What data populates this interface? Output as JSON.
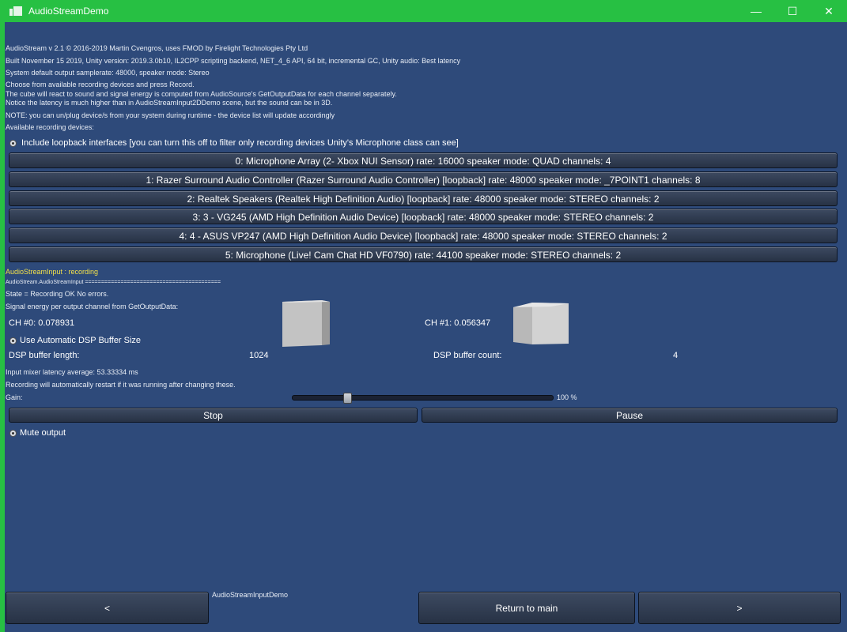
{
  "window": {
    "title": "AudioStreamDemo",
    "minimize": "—",
    "maximize": "☐",
    "close": "✕"
  },
  "info": {
    "line1": "AudioStream v 2.1 © 2016-2019 Martin Cvengros, uses FMOD by Firelight Technologies Pty Ltd",
    "line2": "Built November 15 2019, Unity version: 2019.3.0b10, IL2CPP scripting backend, NET_4_6 API, 64 bit, incremental GC,  Unity audio: Best latency",
    "line3": "System default output samplerate: 48000, speaker mode: Stereo",
    "line4": "Choose from available recording devices and press Record.",
    "line5": "The cube will react to sound and signal energy is computed from AudioSource's GetOutputData for each channel separately.",
    "line6": "Notice the latency is much higher than in AudioStreamInput2DDemo scene, but the sound can be in 3D.",
    "line7": "NOTE: you can un/plug device/s from your system during runtime - the device list will update accordingly",
    "line8": "Available recording devices:"
  },
  "loopback_toggle": {
    "label": "Include loopback interfaces [you can turn this off to filter only recording devices Unity's Microphone class can see]"
  },
  "devices": [
    "0: Microphone Array (2- Xbox NUI Sensor) rate: 16000 speaker mode: QUAD channels: 4",
    "1: Razer Surround Audio Controller (Razer Surround Audio Controller) [loopback] rate: 48000 speaker mode: _7POINT1 channels: 8",
    "2: Realtek Speakers (Realtek High Definition Audio) [loopback] rate: 48000 speaker mode: STEREO channels: 2",
    "3: 3 - VG245 (AMD High Definition Audio Device) [loopback] rate: 48000 speaker mode: STEREO channels: 2",
    "4: 4 - ASUS VP247 (AMD High Definition Audio Device) [loopback] rate: 48000 speaker mode: STEREO channels: 2",
    "5: Microphone (Live! Cam Chat HD VF0790) rate: 44100 speaker mode: STEREO channels: 2"
  ],
  "status": {
    "recording": "AudioStreamInput : recording",
    "log": "AudioStream.AudioStreamInput  ==========================================",
    "state": "State = Recording OK No errors.",
    "energy_header": "Signal energy per output channel from GetOutputData:",
    "ch0": "CH #0: 0.078931",
    "ch1": "CH #1: 0.056347"
  },
  "dsp": {
    "auto_label": "Use Automatic DSP Buffer Size",
    "length_label": "DSP buffer length:",
    "length_value": "1024",
    "count_label": "DSP buffer count:",
    "count_value": "4",
    "latency": "Input mixer latency average: 53.33334 ms",
    "restart_note": "Recording will automatically restart if it was running after changing these."
  },
  "gain": {
    "label": "Gain:",
    "value_text": "100 %",
    "level": 0.2
  },
  "controls": {
    "stop": "Stop",
    "pause": "Pause",
    "mute": "Mute output"
  },
  "footer": {
    "prev": "<",
    "scene_name": "AudioStreamInputDemo",
    "return": "Return to main",
    "next": ">"
  },
  "colors": {
    "background": "#2e4a7a",
    "titlebar": "#27c043",
    "recording_text": "#f2e04a"
  }
}
